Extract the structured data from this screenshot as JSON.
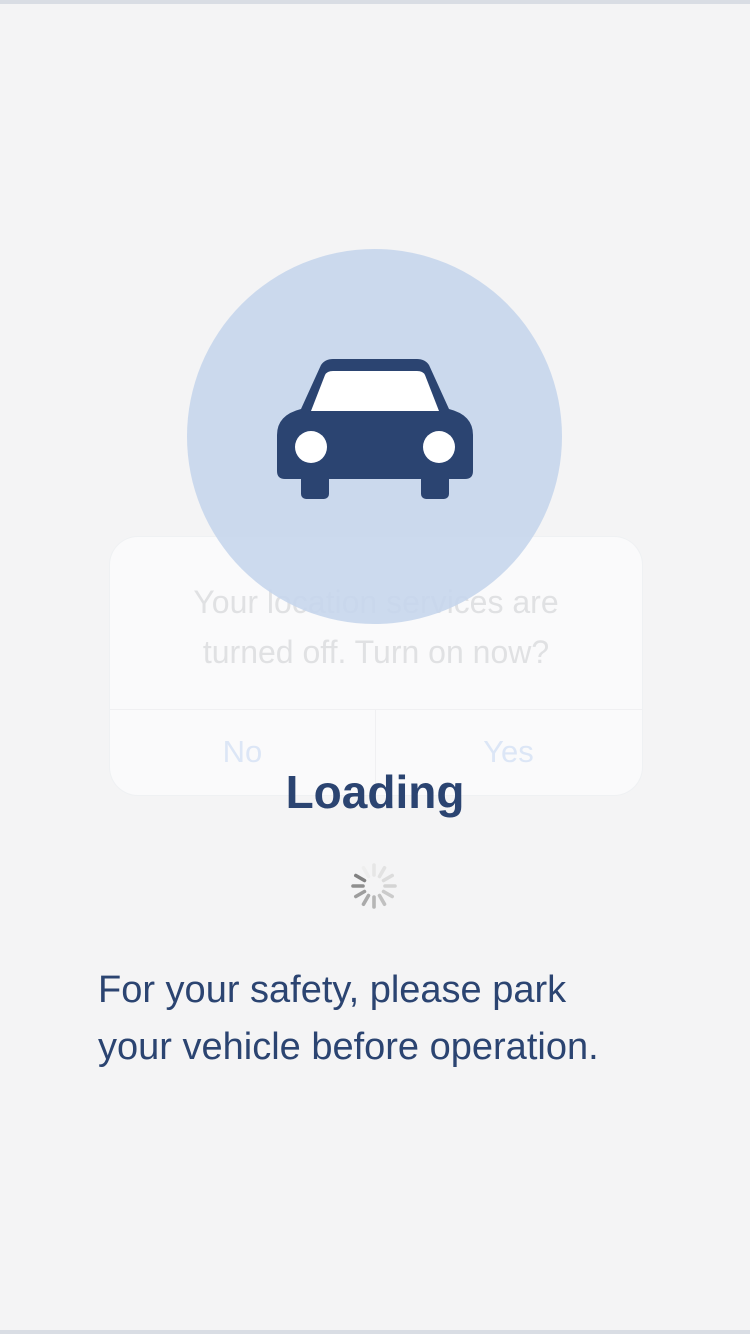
{
  "alert": {
    "message": "Your location services are\nturned off. Turn on now?",
    "no_label": "No",
    "yes_label": "Yes"
  },
  "overlay": {
    "icon": "car-icon",
    "title": "Loading",
    "spinner": "activity-spinner-icon",
    "message": "For your safety, please park\nyour vehicle before operation."
  },
  "colors": {
    "background": "#f4f4f5",
    "accent": "#2b4471",
    "circle": "#c6d6ec",
    "ghost_text": "#e0e1e3",
    "ghost_button": "#dce6f6"
  }
}
